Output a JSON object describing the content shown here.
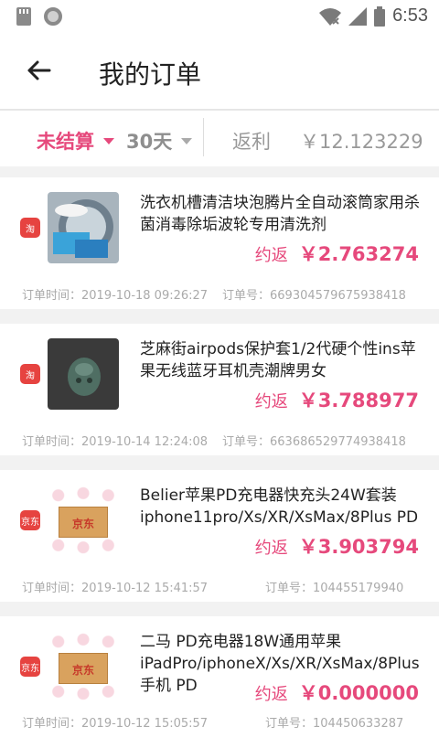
{
  "status_bar": {
    "time": "6:53"
  },
  "app_bar": {
    "title": "我的订单"
  },
  "filter": {
    "status": "未结算",
    "range": "30天",
    "rebate_label": "返利",
    "rebate_value": "￥12.123229"
  },
  "colors": {
    "accent": "#e6497c",
    "taobao": "#e64340"
  },
  "orders": [
    {
      "platform": "淘",
      "title": "洗衣机槽清洁块泡腾片全自动滚筒家用杀菌消毒除垢波轮专用清洗剂",
      "est_label": "约返",
      "amount": "￥2.763274",
      "time": "订单时间：2019-10-18 09:26:27",
      "order_no": "订单号：669304579675938418"
    },
    {
      "platform": "淘",
      "title": "芝麻街airpods保护套1/2代硬个性ins苹果无线蓝牙耳机壳潮牌男女",
      "est_label": "约返",
      "amount": "￥3.788977",
      "time": "订单时间：2019-10-14 12:24:08",
      "order_no": "订单号：663686529774938418"
    },
    {
      "platform": "京东",
      "title": "Belier苹果PD充电器快充头24W套装iphone11pro/Xs/XR/XsMax/8Plus PD",
      "est_label": "约返",
      "amount": "￥3.903794",
      "time": "订单时间：2019-10-12 15:41:57",
      "order_no": "订单号：104455179940"
    },
    {
      "platform": "京东",
      "title": "二马 PD充电器18W通用苹果iPadPro/iphoneX/Xs/XR/XsMax/8Plus手机 PD",
      "est_label": "约返",
      "amount": "￥0.000000",
      "time": "订单时间：2019-10-12 15:05:57",
      "order_no": "订单号：104450633287"
    }
  ],
  "jd_box_label": "京东"
}
